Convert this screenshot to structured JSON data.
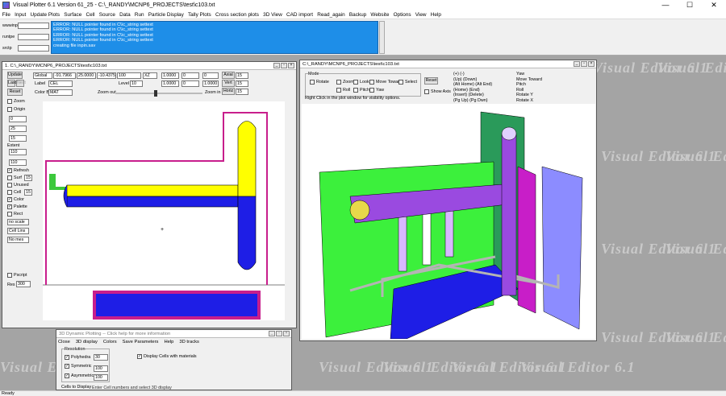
{
  "app": {
    "title": "Visual Plotter 6.1 Version 61_25  - C:\\_RANDY\\MCNP6_PROJECTS\\test\\c103.txt",
    "min": "—",
    "max": "☐",
    "close": "✕"
  },
  "menu": [
    "File",
    "Input",
    "Update Plots",
    "Surface",
    "Cell",
    "Source",
    "Data",
    "Run",
    "Particle Display",
    "Tally Plots",
    "Cross section plots",
    "3D View",
    "CAD import",
    "Read_again",
    "Backup",
    "Website",
    "Options",
    "View",
    "Help"
  ],
  "side_fields": [
    {
      "label": "wwwinp",
      "value": ""
    },
    {
      "label": "runtpe",
      "value": ""
    },
    {
      "label": "srctp",
      "value": ""
    }
  ],
  "console_lines": [
    "ERROR: NULL pointer found in C\\\\c_string settext",
    "ERROR: NULL pointer found in C\\\\c_string settext",
    "ERROR: NULL pointer found in C\\\\c_string settext",
    "ERROR: NULL pointer found in C\\\\c_string settext",
    "creating file inpin.sav"
  ],
  "watermark": "Visual Editor 6.1",
  "plot2d": {
    "title": "1.  C:\\_RANDY\\MCNP6_PROJECTS\\test\\c103.txt",
    "origin_fields": [
      "Global",
      "-91.7966",
      "25.0000",
      "-10.4375",
      "100",
      "XZ",
      "1.0000",
      "0",
      "0",
      "1.0000"
    ],
    "axial_label": "Axial",
    "axial_value": "15",
    "vert_label": "Vert",
    "vert_value": "15",
    "horiz_label": "Horiz",
    "horiz_value": "15",
    "label_label": "Label",
    "label_value": "CEL",
    "level_label": "Level",
    "level_value": "10",
    "color_by_label": "Color By",
    "color_by_value": "MAT",
    "zoom_out": "Zoom out",
    "zoom_in": "Zoom in",
    "left_buttons": [
      "Update",
      "Last",
      "Next",
      "Reset"
    ],
    "left_checks": [
      {
        "label": "Zoom",
        "checked": false
      },
      {
        "label": "Origin",
        "checked": false
      }
    ],
    "left_values": [
      "0",
      "25",
      "15"
    ],
    "extent_label": "Extent",
    "extent_values": [
      "110",
      "110"
    ],
    "option_checks": [
      {
        "label": "Refresh",
        "checked": true
      },
      {
        "label": "Surf",
        "checked": false,
        "value": "15"
      },
      {
        "label": "Unused",
        "checked": false
      },
      {
        "label": "Cell",
        "checked": false,
        "value": "15"
      },
      {
        "label": "Color",
        "checked": true
      },
      {
        "label": "Palette",
        "checked": true
      },
      {
        "label": "Rect",
        "checked": false
      }
    ],
    "scale_select": "no scale",
    "line_select": "Cell Lins",
    "mesh_select": "No mes",
    "pscript_label": "Pscript",
    "res_label": "Res",
    "res_value": "300",
    "cursor": "+"
  },
  "plot3d": {
    "title": "C:\\_RANDY\\MCNP6_PROJECTS\\test\\c103.txt",
    "mode_label": "Mode",
    "mode_checks": [
      [
        "Rotate",
        "Zoom",
        "Look",
        "Move Toward",
        "Select"
      ],
      [
        "Roll",
        "Pitch",
        "Yaw"
      ]
    ],
    "reset_label": "Reset",
    "show_axis_label": "Show Axis",
    "hint": "Right Click in the plot window for visibility options.",
    "keys_left": [
      "(+) (-)",
      "(Up) (Down)",
      "(Alt Home) (Alt End)",
      "(Home) (End)",
      "(Insert) (Delete)",
      "(Pg Up) (Pg Dwn)"
    ],
    "keys_right": [
      "Yaw",
      "Move Toward",
      "Pitch",
      "Roll",
      "Rotate Y",
      "Rotate X"
    ]
  },
  "dyn": {
    "title": "3D Dynamic Plotting -- Click help for more information",
    "menu": [
      "Close",
      "3D display",
      "Colors",
      "Save Parameters",
      "Help",
      "3D tracks"
    ],
    "resolution_label": "Resolution",
    "rows": [
      {
        "label": "Polyhedra",
        "value": "30"
      },
      {
        "label": "Symmetric",
        "value": "100"
      },
      {
        "label": "Asymmetric",
        "value": "100"
      }
    ],
    "display_cells_label": "Display Cells with materials",
    "cells_label": "Cells to Display",
    "instr1": "Enter Cell numbers and select 3D display",
    "instr2": "Enter cell numbers or cell ranges separated by spaces or commas.  For example: 1 4 5-8 9"
  },
  "status": "Ready",
  "colors": {
    "yellow": "#ffff00",
    "blue": "#1e1ee6",
    "pink": "#c81e8c",
    "purple": "#9a4ae0",
    "green": "#3cf03c",
    "console": "#1e8ee8"
  }
}
